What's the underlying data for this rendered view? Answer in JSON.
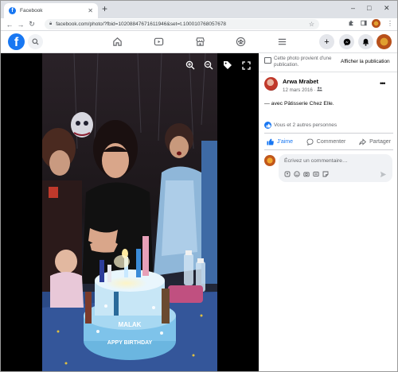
{
  "browser": {
    "tab_title": "Facebook",
    "new_tab": "+",
    "url": "facebook.com/photo/?fbid=10208847671611946&set=t.100010768057678",
    "window_controls": [
      "–",
      "□",
      "✕"
    ]
  },
  "fb_header": {
    "logo": "f",
    "icons": [
      "search-icon",
      "home-icon",
      "watch-icon",
      "marketplace-icon",
      "groups-icon",
      "menu-icon"
    ],
    "right_icons": [
      "create-icon",
      "messenger-icon",
      "notifications-icon",
      "account-avatar"
    ]
  },
  "viewer": {
    "controls": [
      "zoom-in-icon",
      "zoom-out-icon",
      "tag-icon",
      "fullscreen-icon"
    ],
    "photo": {
      "cake_text_1": "MALAK",
      "cake_text_2": "APPY BIRTHDAY"
    }
  },
  "panel": {
    "banner_text": "Cette photo provient d'une publication.",
    "banner_link": "Afficher la publication",
    "author_name": "Arwa Mrabet",
    "post_date": "12 mars 2016 · ",
    "with_prefix": "— avec ",
    "with_name": "Pâtisserie Chez Elle",
    "with_suffix": ".",
    "reactions_text": "Vous et 2 autres personnes",
    "actions": {
      "like": "J'aime",
      "comment": "Commenter",
      "share": "Partager"
    },
    "comment_placeholder": "Écrivez un commentaire…"
  },
  "colors": {
    "fb_blue": "#1877f2",
    "secondary_text": "#65676b"
  }
}
